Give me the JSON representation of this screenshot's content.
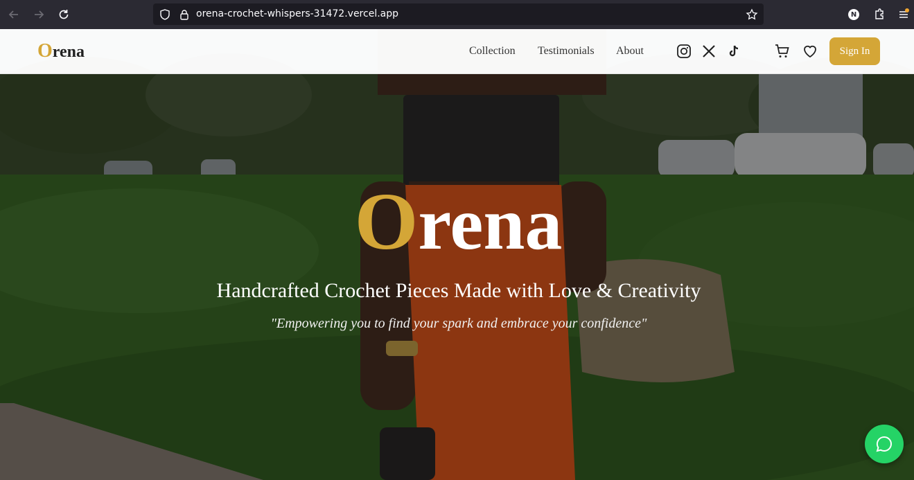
{
  "browser": {
    "url": "orena-crochet-whispers-31472.vercel.app",
    "profile_initial": "N"
  },
  "header": {
    "logo_first": "O",
    "logo_rest": "rena",
    "nav": [
      "Collection",
      "Testimonials",
      "About"
    ],
    "signin_label": "Sign In",
    "social_icons": [
      "instagram-icon",
      "x-icon",
      "tiktok-icon"
    ]
  },
  "hero": {
    "title_first": "O",
    "title_rest": "rena",
    "subtitle": "Handcrafted Crochet Pieces Made with Love & Creativity",
    "quote": "\"Empowering you to find your spark and embrace your confidence\""
  },
  "colors": {
    "accent": "#d4a637",
    "whatsapp": "#25d366"
  }
}
